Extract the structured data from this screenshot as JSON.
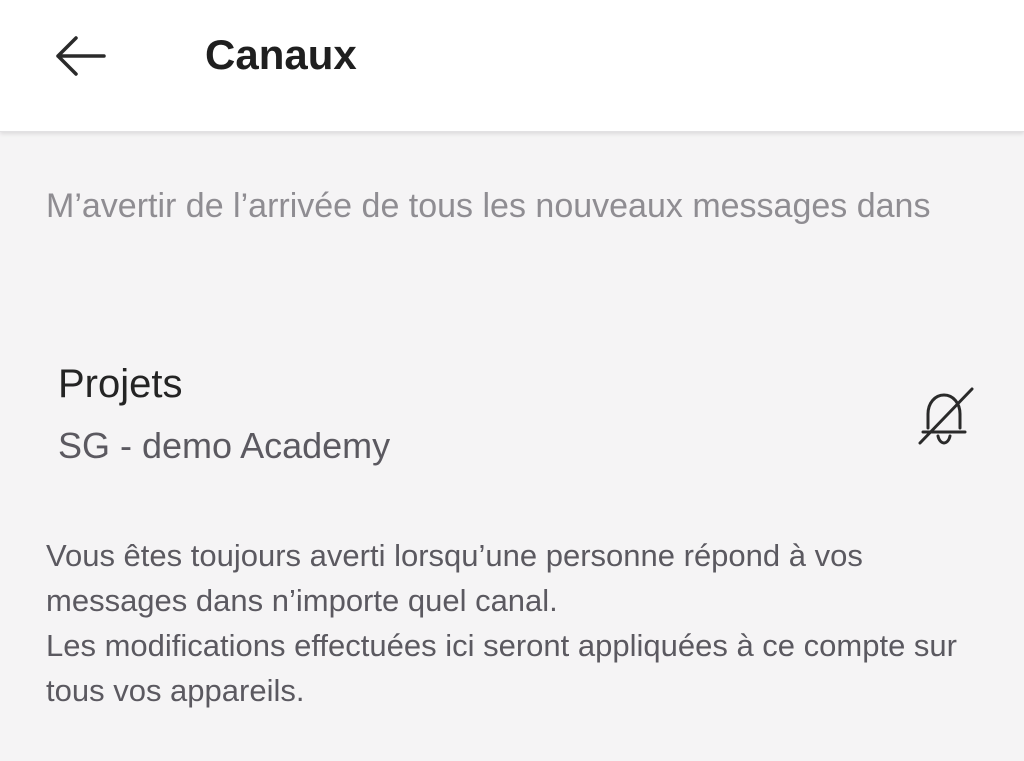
{
  "header": {
    "title": "Canaux",
    "back_icon": "arrow-left-icon"
  },
  "intro": {
    "text": "M’avertir de l’arrivée de tous les nouveaux messages dans"
  },
  "channel_group": {
    "team_name": "Projets",
    "channel_name": "SG - demo Academy",
    "notification_icon": "bell-off-icon"
  },
  "footer": {
    "line1": "Vous êtes toujours averti lorsqu’une personne répond à vos messages dans n’importe quel canal.",
    "line2": "Les modifications effectuées ici seront appliquées à ce compte sur tous vos appareils."
  },
  "colors": {
    "background": "#f5f4f5",
    "header_background": "#ffffff",
    "title_text": "#1f1f1f",
    "muted_text": "#8f8d92",
    "secondary_text": "#5b5960"
  }
}
